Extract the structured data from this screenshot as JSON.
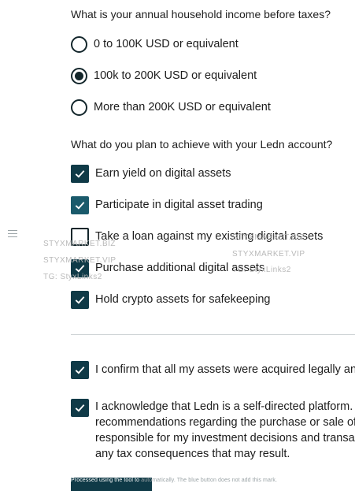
{
  "income": {
    "question": "What is your annual household income before taxes?",
    "options": [
      {
        "label": "0 to 100K USD or equivalent",
        "selected": false
      },
      {
        "label": "100k to 200K USD or equivalent",
        "selected": true
      },
      {
        "label": "More than 200K USD or equivalent",
        "selected": false
      }
    ]
  },
  "goals": {
    "question": "What do you plan to achieve with your Ledn account?",
    "options": [
      {
        "label": "Earn yield on digital assets",
        "checked": true
      },
      {
        "label": "Participate in digital asset trading",
        "checked": true
      },
      {
        "label": "Take a loan against my existing digital assets",
        "checked": false
      },
      {
        "label": "Purchase additional digital assets",
        "checked": true
      },
      {
        "label": "Hold crypto assets for safekeeping",
        "checked": true
      }
    ]
  },
  "confirmations": [
    {
      "lines": [
        "I confirm that all my assets were acquired legally and"
      ],
      "checked": true
    },
    {
      "lines": [
        "I acknowledge that Ledn is a self-directed platform.",
        "recommendations regarding the purchase or sale of",
        "responsible for my investment decisions and transac",
        "any tax consequences that may result."
      ],
      "checked": true
    }
  ],
  "watermarks": {
    "left": [
      "STYXMARKET.BIZ",
      "STYXMARKET.VIP",
      "TG: StyxLinks2"
    ],
    "right": [
      "STYXMARKET.BIZ",
      "STYXMARKET.VIP",
      "TG: StyxLinks2"
    ]
  },
  "footer": {
    "note_start": "Processed using the tool to",
    "note_end": "automatically. The blue button does not add this mark."
  },
  "colors": {
    "accent": "#0f3a47",
    "accent_alt": "#1a5a6b"
  }
}
